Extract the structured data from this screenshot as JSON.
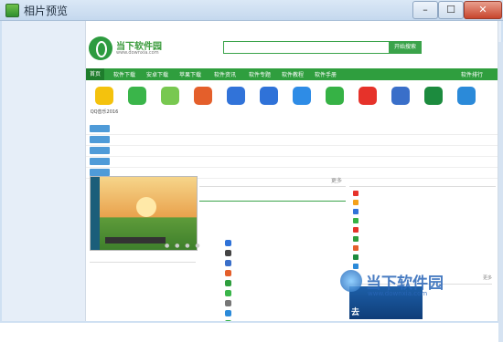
{
  "window": {
    "title": "相片预览"
  },
  "header": {
    "site_name": "当下软件园",
    "url_text": "www.downxia.com",
    "search_button": "开始搜索"
  },
  "nav": [
    "首页",
    "软件下载",
    "安卓下载",
    "苹果下载",
    "软件资讯",
    "软件专题",
    "软件教程",
    "软件手册",
    "软件排行"
  ],
  "apps": [
    {
      "label": "QQ音乐2016",
      "color": "#f4c20d"
    },
    {
      "label": "",
      "color": "#3ab54a"
    },
    {
      "label": "",
      "color": "#78c850"
    },
    {
      "label": "",
      "color": "#e45f2b"
    },
    {
      "label": "",
      "color": "#3173d9"
    },
    {
      "label": "",
      "color": "#2f72d8"
    },
    {
      "label": "",
      "color": "#2e8ce6"
    },
    {
      "label": "",
      "color": "#36b245"
    },
    {
      "label": "",
      "color": "#e6322a"
    },
    {
      "label": "",
      "color": "#3a6fc9"
    },
    {
      "label": "",
      "color": "#1c8b3e"
    },
    {
      "label": "",
      "color": "#2b8ad9"
    }
  ],
  "categories": [
    {
      "tag": "",
      "text": ""
    },
    {
      "tag": "",
      "text": ""
    },
    {
      "tag": "",
      "text": ""
    },
    {
      "tag": "",
      "text": ""
    },
    {
      "tag": "",
      "text": ""
    }
  ],
  "screenshot_caption": "",
  "left_news": {
    "header": "",
    "big": "",
    "items": [
      "",
      "",
      ""
    ]
  },
  "middle": {
    "header": "",
    "more": "更多",
    "promo_title": "",
    "promo_lines": [
      "",
      ""
    ],
    "tabs": [
      "",
      "",
      "",
      "",
      ""
    ],
    "sublist": [
      "",
      "",
      "",
      "",
      "",
      "",
      "",
      "",
      ""
    ],
    "downloads": [
      {
        "title": "",
        "badge": "",
        "color": "#2f72d8"
      },
      {
        "title": "",
        "badge": "",
        "color": "#444"
      },
      {
        "title": "",
        "badge": "",
        "color": "#3a6fc9"
      },
      {
        "title": "",
        "badge": "",
        "color": "#e45f2b"
      },
      {
        "title": "",
        "badge": "",
        "color": "#2f9e3e"
      },
      {
        "title": "",
        "badge": "",
        "color": "#3ab54a"
      },
      {
        "title": "",
        "badge": "",
        "color": "#777"
      },
      {
        "title": "",
        "badge": "",
        "color": "#2b8ad9"
      },
      {
        "title": "",
        "badge": "",
        "color": "#36b245"
      }
    ]
  },
  "right": {
    "header": "",
    "ranks": [
      {
        "name": "",
        "ver": "",
        "color": "#e6322a"
      },
      {
        "name": "",
        "ver": "",
        "color": "#f4a11a"
      },
      {
        "name": "",
        "ver": "",
        "color": "#3173d9"
      },
      {
        "name": "",
        "ver": "",
        "color": "#36b245"
      },
      {
        "name": "",
        "ver": "",
        "color": "#e6322a"
      },
      {
        "name": "",
        "ver": "",
        "color": "#2f9e3e"
      },
      {
        "name": "",
        "ver": "",
        "color": "#e45f2b"
      },
      {
        "name": "",
        "ver": "",
        "color": "#1c8b3e"
      },
      {
        "name": "",
        "ver": "",
        "color": "#2b8ad9"
      }
    ],
    "bottom_header": "",
    "bottom_more": "更多",
    "banner_l1": "",
    "banner_l2": "去"
  },
  "watermark": {
    "text": "当下软件园",
    "url": "www.downxia.com"
  }
}
